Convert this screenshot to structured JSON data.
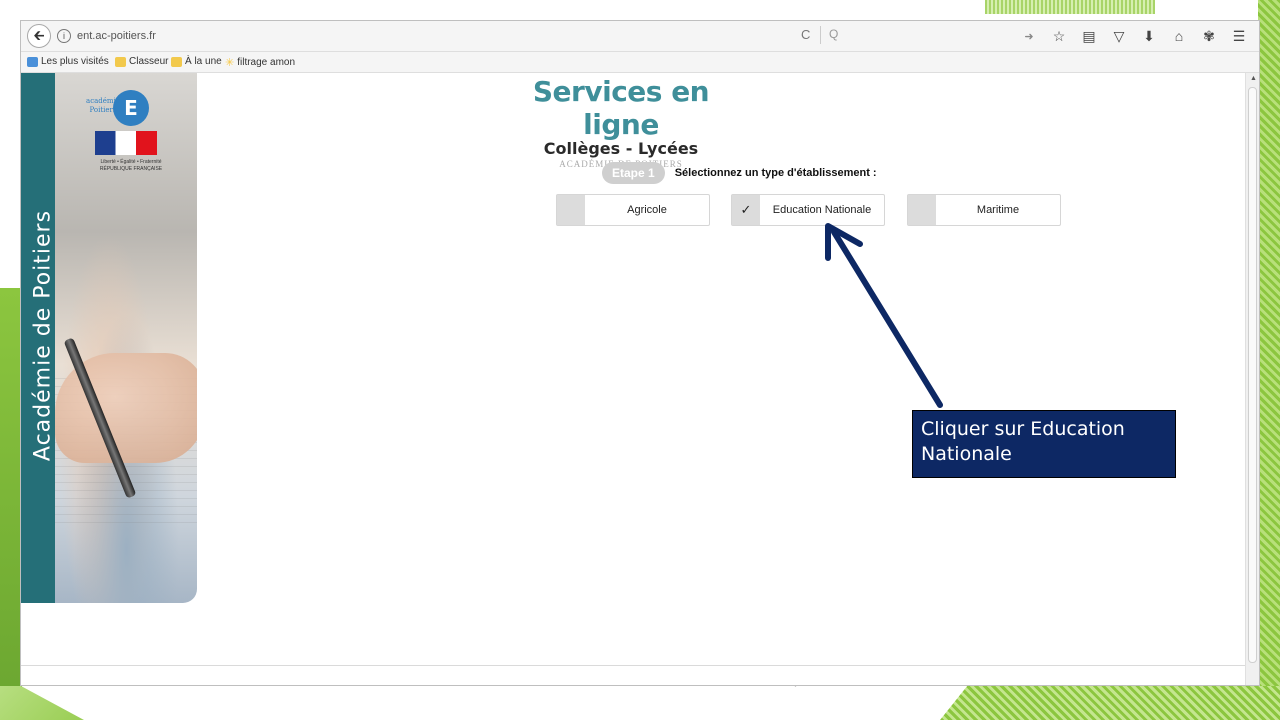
{
  "browser": {
    "url": "ent.ac-poitiers.fr",
    "search_placeholder": "Q",
    "reload_icon": "C",
    "bookmarks": [
      {
        "label": "Les plus visités",
        "icon": "bookmark-icon",
        "color": "#4a90d9"
      },
      {
        "label": "Classeur",
        "icon": "folder-icon",
        "color": "#f2c94c"
      },
      {
        "label": "À la une",
        "icon": "rss-icon",
        "color": "#f2c94c"
      },
      {
        "label": "filtrage amon",
        "icon": "star-icon",
        "color": "#f7d85a"
      }
    ],
    "toolbar_icons": [
      "arrow-right-icon",
      "star-icon",
      "reading-list-icon",
      "pocket-icon",
      "download-icon",
      "home-icon",
      "extension-icon",
      "menu-icon"
    ]
  },
  "sidebar": {
    "vertical_text": "Académie de Poitiers",
    "logo_text": "académie Poitiers",
    "logo_letter": "E",
    "marianne_caption": "Liberté • Égalité • Fraternité RÉPUBLIQUE FRANÇAISE"
  },
  "header": {
    "title": "Services en ligne",
    "subtitle": "Collèges - Lycées",
    "academie": "ACADÉMIE DE POITIERS"
  },
  "step": {
    "pill": "Etape 1",
    "label": "Sélectionnez un type d'établissement :"
  },
  "choices": [
    {
      "label": "Agricole",
      "checked": ""
    },
    {
      "label": "Education Nationale",
      "checked": "✓"
    },
    {
      "label": "Maritime",
      "checked": ""
    }
  ],
  "annotation": {
    "text": "Cliquer sur Education Nationale",
    "color": "#0d2864"
  },
  "colors": {
    "accent": "#3f8f9a",
    "sidebar_band": "#256f78",
    "slide_green": "#8cc63f"
  }
}
